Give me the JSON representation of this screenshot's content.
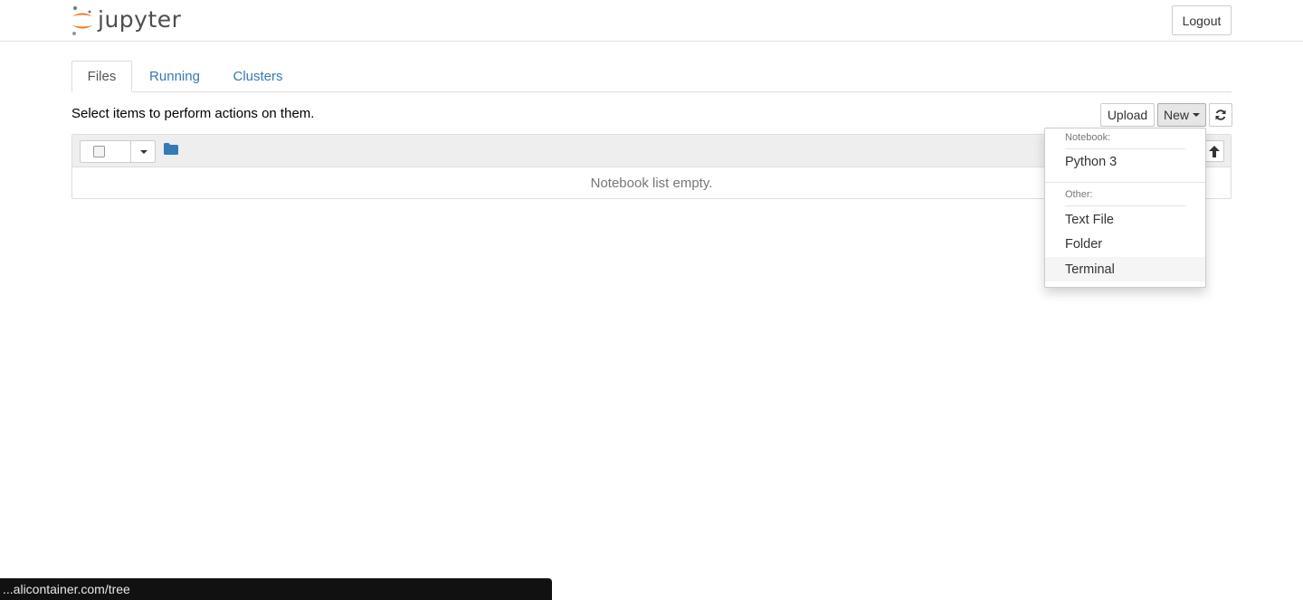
{
  "header": {
    "logo_text": "jupyter",
    "logout_label": "Logout"
  },
  "tabs": [
    {
      "label": "Files",
      "active": true
    },
    {
      "label": "Running",
      "active": false
    },
    {
      "label": "Clusters",
      "active": false
    }
  ],
  "instructions": "Select items to perform actions on them.",
  "toolbar": {
    "upload_label": "Upload",
    "new_label": "New",
    "refresh_icon": "refresh-icon"
  },
  "notebook_list": {
    "empty_message": "Notebook list empty."
  },
  "new_menu": {
    "notebook_header": "Notebook:",
    "notebook_items": [
      "Python 3"
    ],
    "other_header": "Other:",
    "other_items": [
      "Text File",
      "Folder",
      "Terminal"
    ],
    "highlighted": "Terminal"
  },
  "status_bar": {
    "url": "...alicontainer.com/tree"
  },
  "colors": {
    "link": "#337ab7",
    "logo_orange": "#f37726",
    "logo_gray": "#767677"
  }
}
